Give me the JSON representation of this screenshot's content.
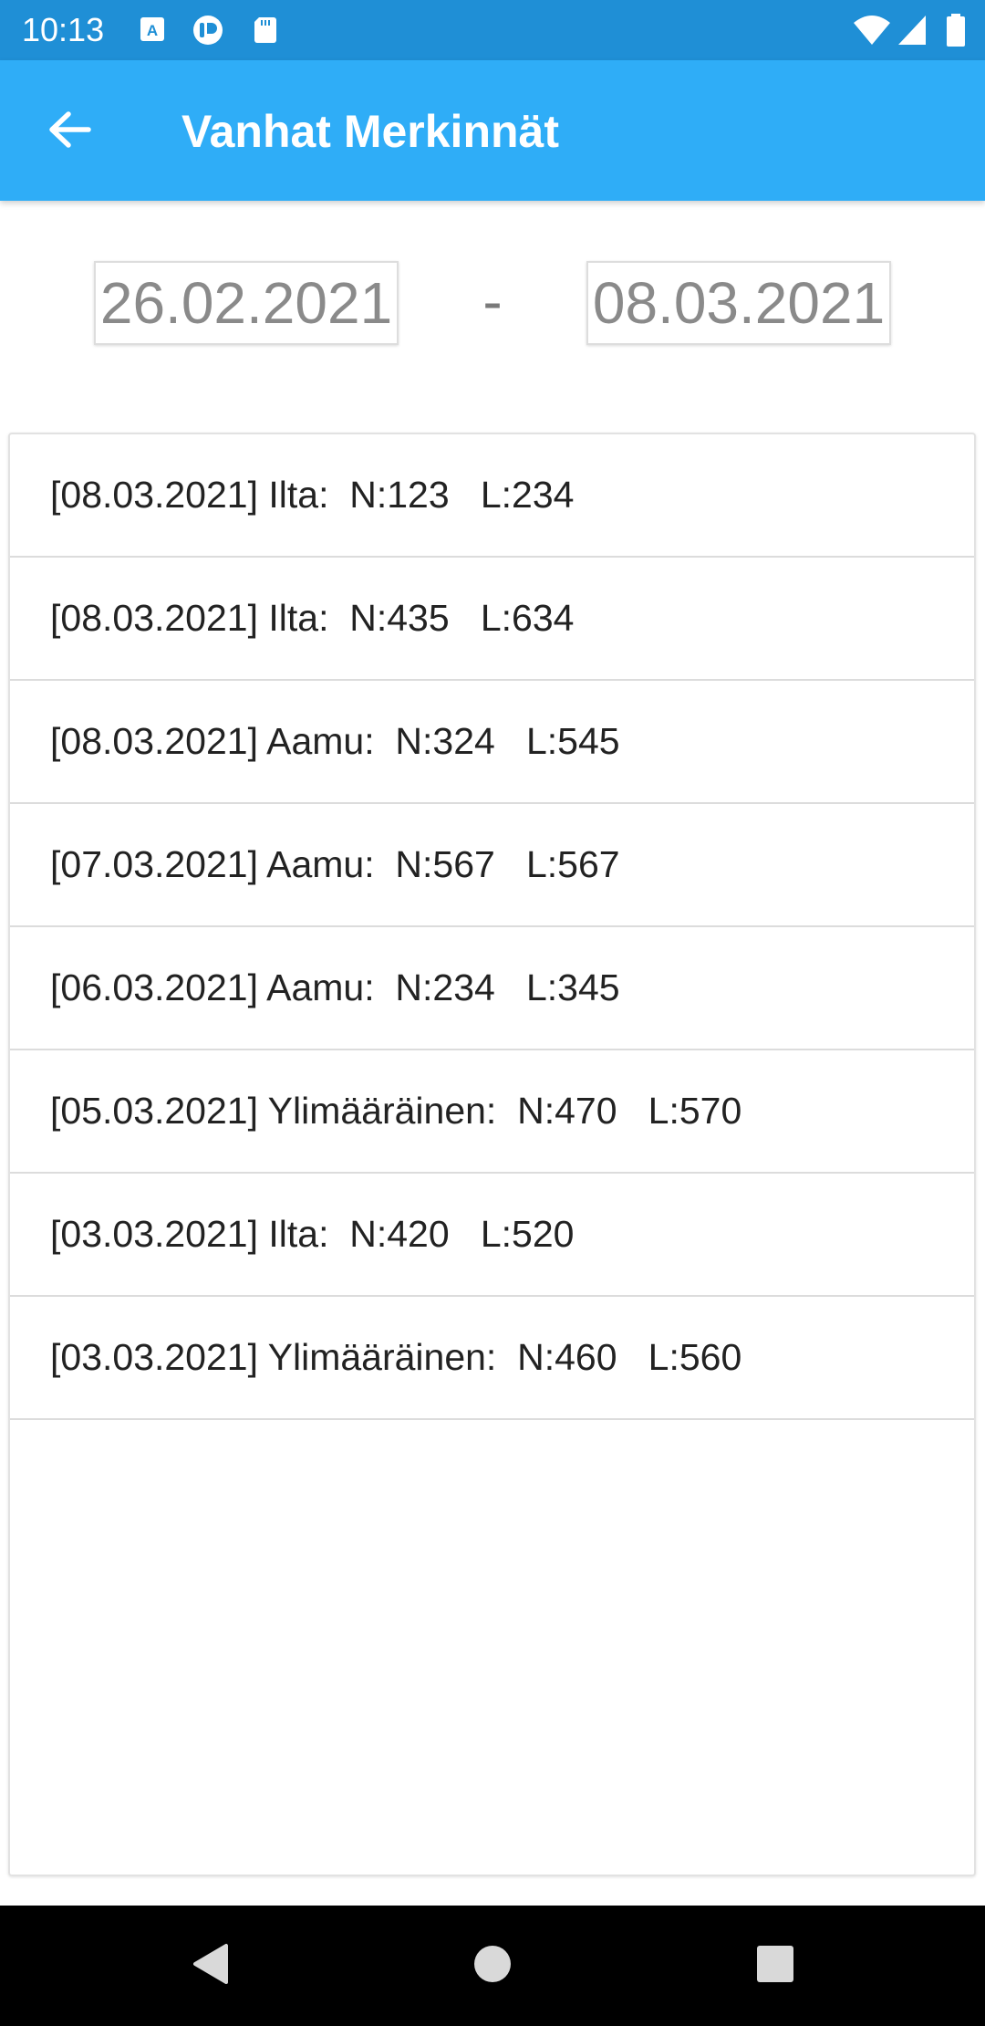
{
  "status_bar": {
    "time": "10:13",
    "left_icons": [
      "a-badge-icon",
      "app-logo-icon",
      "sd-card-icon"
    ],
    "right_icons": [
      "wifi-icon",
      "cell-signal-icon",
      "battery-icon"
    ]
  },
  "app_bar": {
    "back_icon": "arrow-left-icon",
    "title": "Vanhat Merkinnät"
  },
  "date_range": {
    "start": "26.02.2021",
    "separator": "-",
    "end": "08.03.2021"
  },
  "entries": [
    "[08.03.2021] Ilta:  N:123   L:234",
    "[08.03.2021] Ilta:  N:435   L:634",
    "[08.03.2021] Aamu:  N:324   L:545",
    "[07.03.2021] Aamu:  N:567   L:567",
    "[06.03.2021] Aamu:  N:234   L:345",
    "[05.03.2021] Ylimääräinen:  N:470   L:570",
    "[03.03.2021] Ilta:  N:420   L:520",
    "[03.03.2021] Ylimääräinen:  N:460   L:560"
  ],
  "nav_bar": {
    "buttons": [
      "back-triangle-icon",
      "home-circle-icon",
      "recents-square-icon"
    ]
  },
  "colors": {
    "status_bar": "#1f8fd6",
    "app_bar": "#2fadf7",
    "nav_bar": "#000000"
  }
}
